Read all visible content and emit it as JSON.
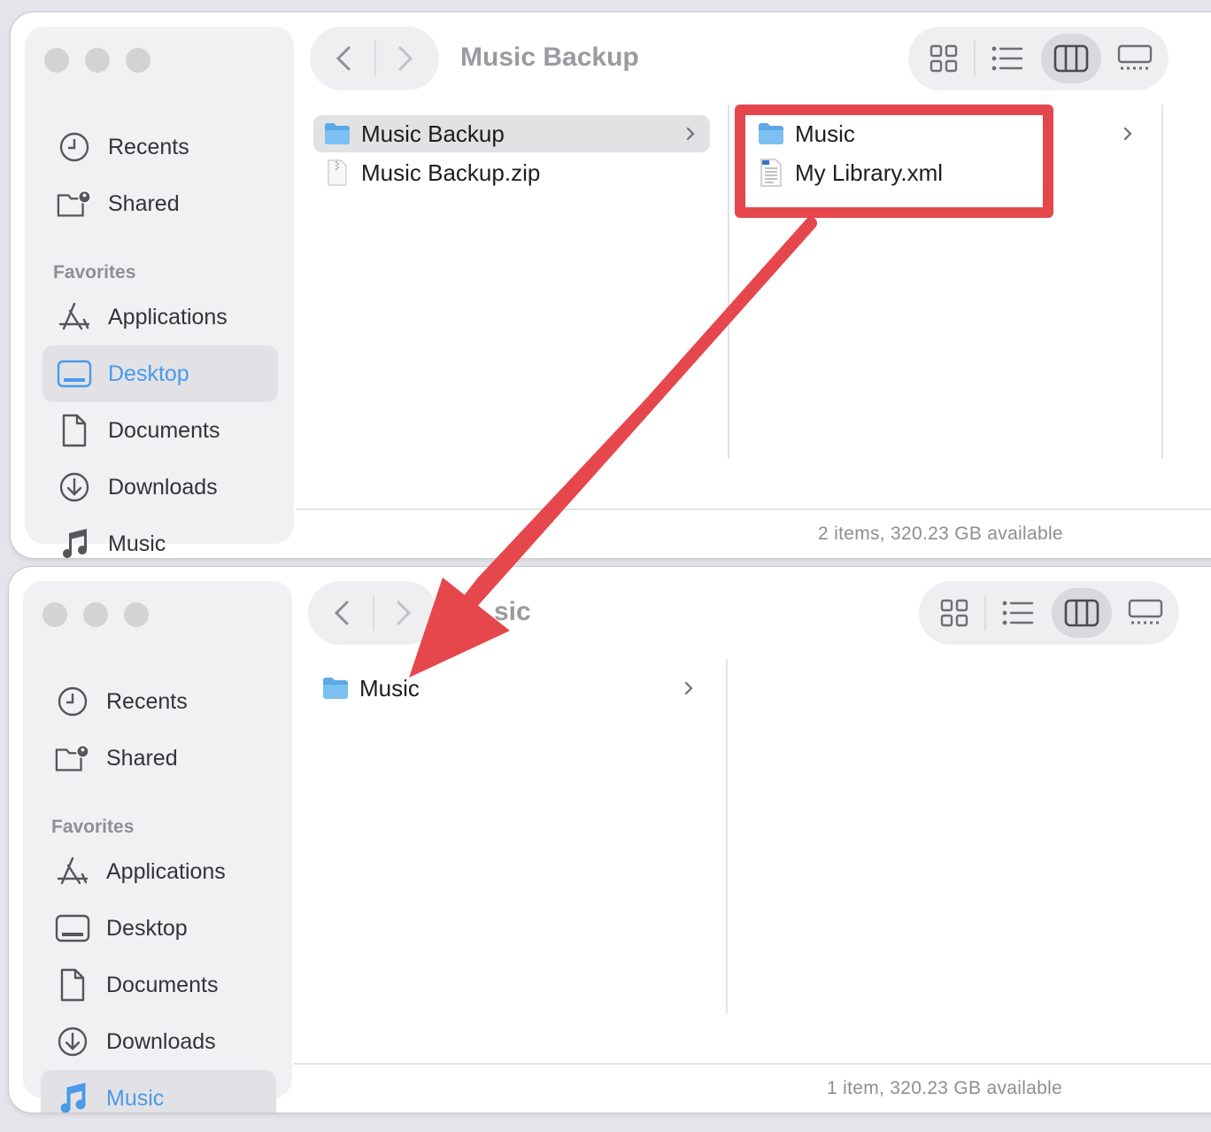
{
  "colors": {
    "accent": "#4a9ae8",
    "annotation": "#e5474d",
    "folder": "#5aa9e6"
  },
  "top_window": {
    "title": "Music Backup",
    "sidebar": {
      "recents": "Recents",
      "shared": "Shared",
      "favorites_header": "Favorites",
      "applications": "Applications",
      "desktop": "Desktop",
      "documents": "Documents",
      "downloads": "Downloads",
      "music": "Music",
      "selected": "Desktop"
    },
    "column1": [
      {
        "name": "Music Backup",
        "icon": "folder-icon",
        "selected": true
      },
      {
        "name": "Music Backup.zip",
        "icon": "zip-file-icon"
      }
    ],
    "column2": [
      {
        "name": "Music",
        "icon": "folder-icon"
      },
      {
        "name": "My Library.xml",
        "icon": "xml-file-icon"
      }
    ],
    "status": "2 items, 320.23 GB available"
  },
  "bottom_window": {
    "title": "sic",
    "sidebar": {
      "recents": "Recents",
      "shared": "Shared",
      "favorites_header": "Favorites",
      "applications": "Applications",
      "desktop": "Desktop",
      "documents": "Documents",
      "downloads": "Downloads",
      "music": "Music",
      "selected": "Music"
    },
    "column1": [
      {
        "name": "Music",
        "icon": "folder-icon"
      }
    ],
    "status": "1 item, 320.23 GB available"
  },
  "view_modes": [
    "icon-view-icon",
    "list-view-icon",
    "column-view-icon",
    "gallery-view-icon"
  ],
  "active_view": "column-view-icon"
}
